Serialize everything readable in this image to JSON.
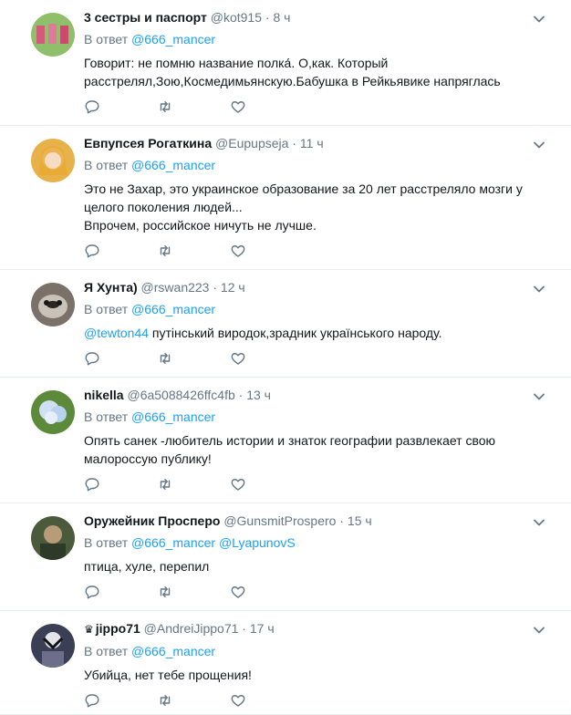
{
  "tweets": [
    {
      "name": "3 сестры и паспорт",
      "handle": "@kot915",
      "time": "8 ч",
      "reply_prefix": "В ответ",
      "reply_to": "@666_mancer",
      "reply_to2": "",
      "text_mention": "",
      "text": "Говорит: не помню название полка́. О,как. Который расстрелял,Зою,Космедимьянскую.Бабушка в Рейкьявике напряглась",
      "avatar_color": "#8fbf6a"
    },
    {
      "name": "Евпупсея Рогаткина",
      "handle": "@Eupupseja",
      "time": "11 ч",
      "reply_prefix": "В ответ",
      "reply_to": "@666_mancer",
      "reply_to2": "",
      "text_mention": "",
      "text": "Это не Захар, это украинское образование за 20 лет расстреляло мозги у целого поколения людей...\nВпрочем, российское ничуть не лучше.",
      "avatar_color": "#e8b24a"
    },
    {
      "name": "Я Хунта)",
      "handle": "@rswan223",
      "time": "12 ч",
      "reply_prefix": "В ответ",
      "reply_to": "@666_mancer",
      "reply_to2": "",
      "text_mention": "@tewton44",
      "text": " путінський виродок,зрадник українського народу.",
      "avatar_color": "#7a7268"
    },
    {
      "name": "nikella",
      "handle": "@6a5088426ffc4fb",
      "time": "13 ч",
      "reply_prefix": "В ответ",
      "reply_to": "@666_mancer",
      "reply_to2": "",
      "text_mention": "",
      "text": "Опять санек -любитель истории и знаток географии развлекает свою малороссую публику!",
      "avatar_color": "#5d8a3a"
    },
    {
      "name": "Оружейник Просперо",
      "handle": "@GunsmitProspero",
      "time": "15 ч",
      "reply_prefix": "В ответ",
      "reply_to": "@666_mancer",
      "reply_to2": "@LyapunovS",
      "text_mention": "",
      "text": "птица, хуле, перепил",
      "avatar_color": "#4a5a3a"
    },
    {
      "name": "jippo71",
      "handle": "@AndreiJippo71",
      "time": "17 ч",
      "reply_prefix": "В ответ",
      "reply_to": "@666_mancer",
      "reply_to2": "",
      "text_mention": "",
      "text": "Убийца, нет тебе прощения!",
      "avatar_color": "#3a3f55"
    }
  ]
}
